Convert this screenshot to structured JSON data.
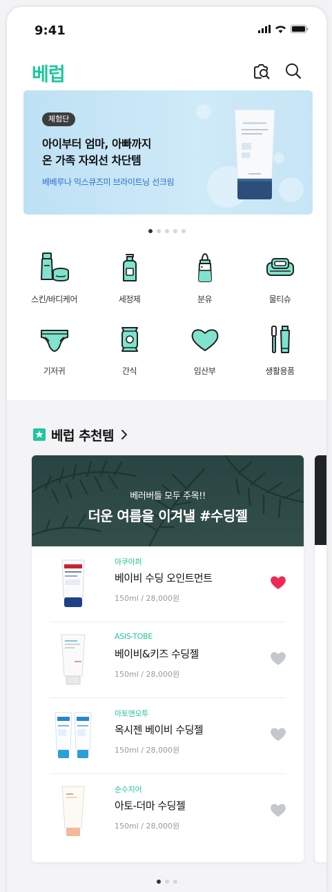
{
  "status": {
    "time": "9:41"
  },
  "header": {
    "logo": "베럽"
  },
  "banner": {
    "badge": "체험단",
    "title_line1": "아이부터 엄마, 아빠까지",
    "title_line2": "온 가족 자외선 차단템",
    "subtitle": "베베루나 익스큐즈미 브라이트닝 선크림",
    "slide_count": 5,
    "active_slide": 1
  },
  "categories": [
    {
      "label": "스킨/바디케어",
      "icon": "skincare-icon"
    },
    {
      "label": "세정제",
      "icon": "pump-bottle-icon"
    },
    {
      "label": "분유",
      "icon": "baby-bottle-icon"
    },
    {
      "label": "물티슈",
      "icon": "wet-wipes-icon"
    },
    {
      "label": "기저귀",
      "icon": "diaper-icon"
    },
    {
      "label": "간식",
      "icon": "snack-icon"
    },
    {
      "label": "임산부",
      "icon": "heart-icon"
    },
    {
      "label": "생활용품",
      "icon": "toothbrush-icon"
    }
  ],
  "recommend": {
    "title": "베럽 추천템",
    "hero_sub": "베러버들 모두 주목!!",
    "hero_title": "더운 여름을 이겨낼 #수딩젤",
    "products": [
      {
        "brand": "아쿠아퍼",
        "name": "베이비 수딩 오인트먼트",
        "price": "150ml / 28,000원",
        "liked": true
      },
      {
        "brand": "ASIS-TOBE",
        "name": "베이비&키즈 수딩젤",
        "price": "150ml / 28,000원",
        "liked": false
      },
      {
        "brand": "아토앤오투",
        "name": "옥시젠 베이비 수딩젤",
        "price": "150ml / 28,000원",
        "liked": false
      },
      {
        "brand": "순수지어",
        "name": "아토-더마 수딩젤",
        "price": "150ml / 28,000원",
        "liked": false
      }
    ],
    "slide_count": 3,
    "active_slide": 1
  },
  "colors": {
    "brand": "#1ec79d",
    "liked_heart": "#ee2a56",
    "unliked_heart": "#c4c7cc"
  }
}
